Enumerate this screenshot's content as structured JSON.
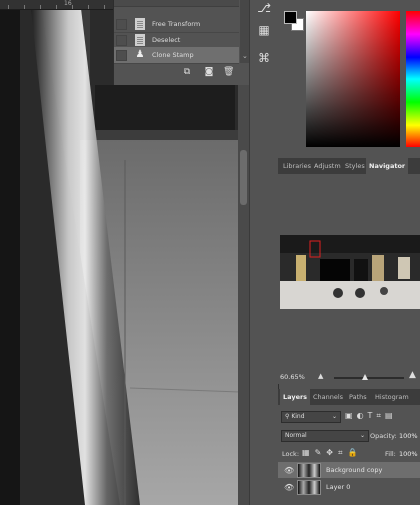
{
  "ruler": {
    "mark": "16"
  },
  "history": {
    "items": [
      {
        "label": "Free Transform",
        "selected": false
      },
      {
        "label": "Deselect",
        "selected": false
      },
      {
        "label": "Clone Stamp",
        "selected": true
      }
    ]
  },
  "tabs_top": [
    {
      "label": "Libraries",
      "active": false
    },
    {
      "label": "Adjustm",
      "active": false
    },
    {
      "label": "Styles",
      "active": false
    },
    {
      "label": "Navigator",
      "active": true
    }
  ],
  "navigator": {
    "zoom": "60.65%"
  },
  "tabs_layers": [
    {
      "label": "Layers",
      "active": true
    },
    {
      "label": "Channels",
      "active": false
    },
    {
      "label": "Paths",
      "active": false
    },
    {
      "label": "Histogram",
      "active": false
    }
  ],
  "layers": {
    "kind_label": "Kind",
    "blend_mode": "Normal",
    "opacity_label": "Opacity:",
    "opacity_value": "100%",
    "lock_label": "Lock:",
    "fill_label": "Fill:",
    "fill_value": "100%",
    "items": [
      {
        "name": "Background copy",
        "selected": true
      },
      {
        "name": "Layer 0",
        "selected": false
      }
    ]
  },
  "colors": {
    "foreground": "#000000",
    "background": "#ffffff"
  }
}
